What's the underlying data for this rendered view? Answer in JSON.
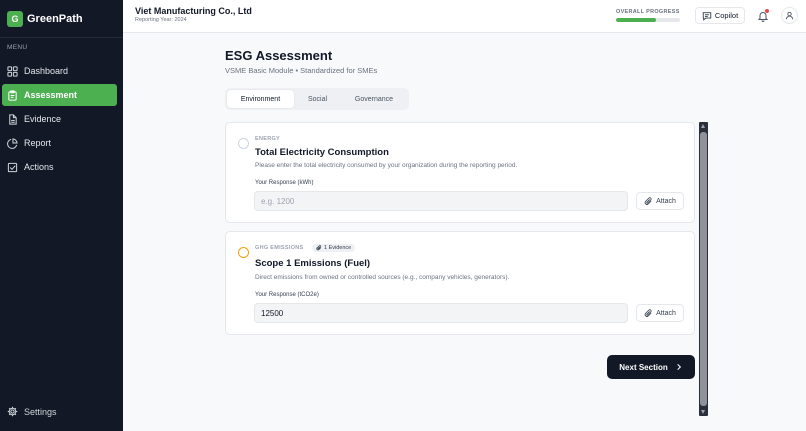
{
  "brand": {
    "badge": "G",
    "name": "GreenPath"
  },
  "sidebar": {
    "menu_label": "MENU",
    "items": [
      {
        "label": "Dashboard",
        "icon": "grid-icon",
        "active": false
      },
      {
        "label": "Assessment",
        "icon": "clipboard-icon",
        "active": true
      },
      {
        "label": "Evidence",
        "icon": "file-icon",
        "active": false
      },
      {
        "label": "Report",
        "icon": "pie-chart-icon",
        "active": false
      },
      {
        "label": "Actions",
        "icon": "check-square-icon",
        "active": false
      }
    ],
    "settings_label": "Settings"
  },
  "header": {
    "company": "Viet Manufacturing Co., Ltd",
    "year": "Reporting Year: 2024",
    "progress_label": "OVERALL PROGRESS",
    "progress_value": 0.62,
    "copilot_label": "Copilot"
  },
  "main": {
    "title": "ESG Assessment",
    "subtitle": "VSME Basic Module • Standardized for SMEs",
    "tabs": [
      {
        "label": "Environment",
        "active": true
      },
      {
        "label": "Social",
        "active": false
      },
      {
        "label": "Governance",
        "active": false
      }
    ],
    "questions": [
      {
        "category": "ENERGY",
        "title": "Total Electricity Consumption",
        "description": "Please enter the total electricity consumed by your organization during the reporting period.",
        "response_label": "Your Response (kWh)",
        "value": "",
        "placeholder": "e.g. 1200",
        "attach_label": "Attach"
      },
      {
        "category": "GHG EMISSIONS",
        "evidence": "1 Evidence",
        "title": "Scope 1 Emissions (Fuel)",
        "description": "Direct emissions from owned or controlled sources (e.g., company vehicles, generators).",
        "response_label": "Your Response (tCO2e)",
        "value": "12500",
        "attach_label": "Attach"
      }
    ],
    "next_label": "Next Section"
  },
  "colors": {
    "accent": "#4caf50",
    "sidebar_bg": "#121826",
    "pending": "#f59e0b"
  }
}
